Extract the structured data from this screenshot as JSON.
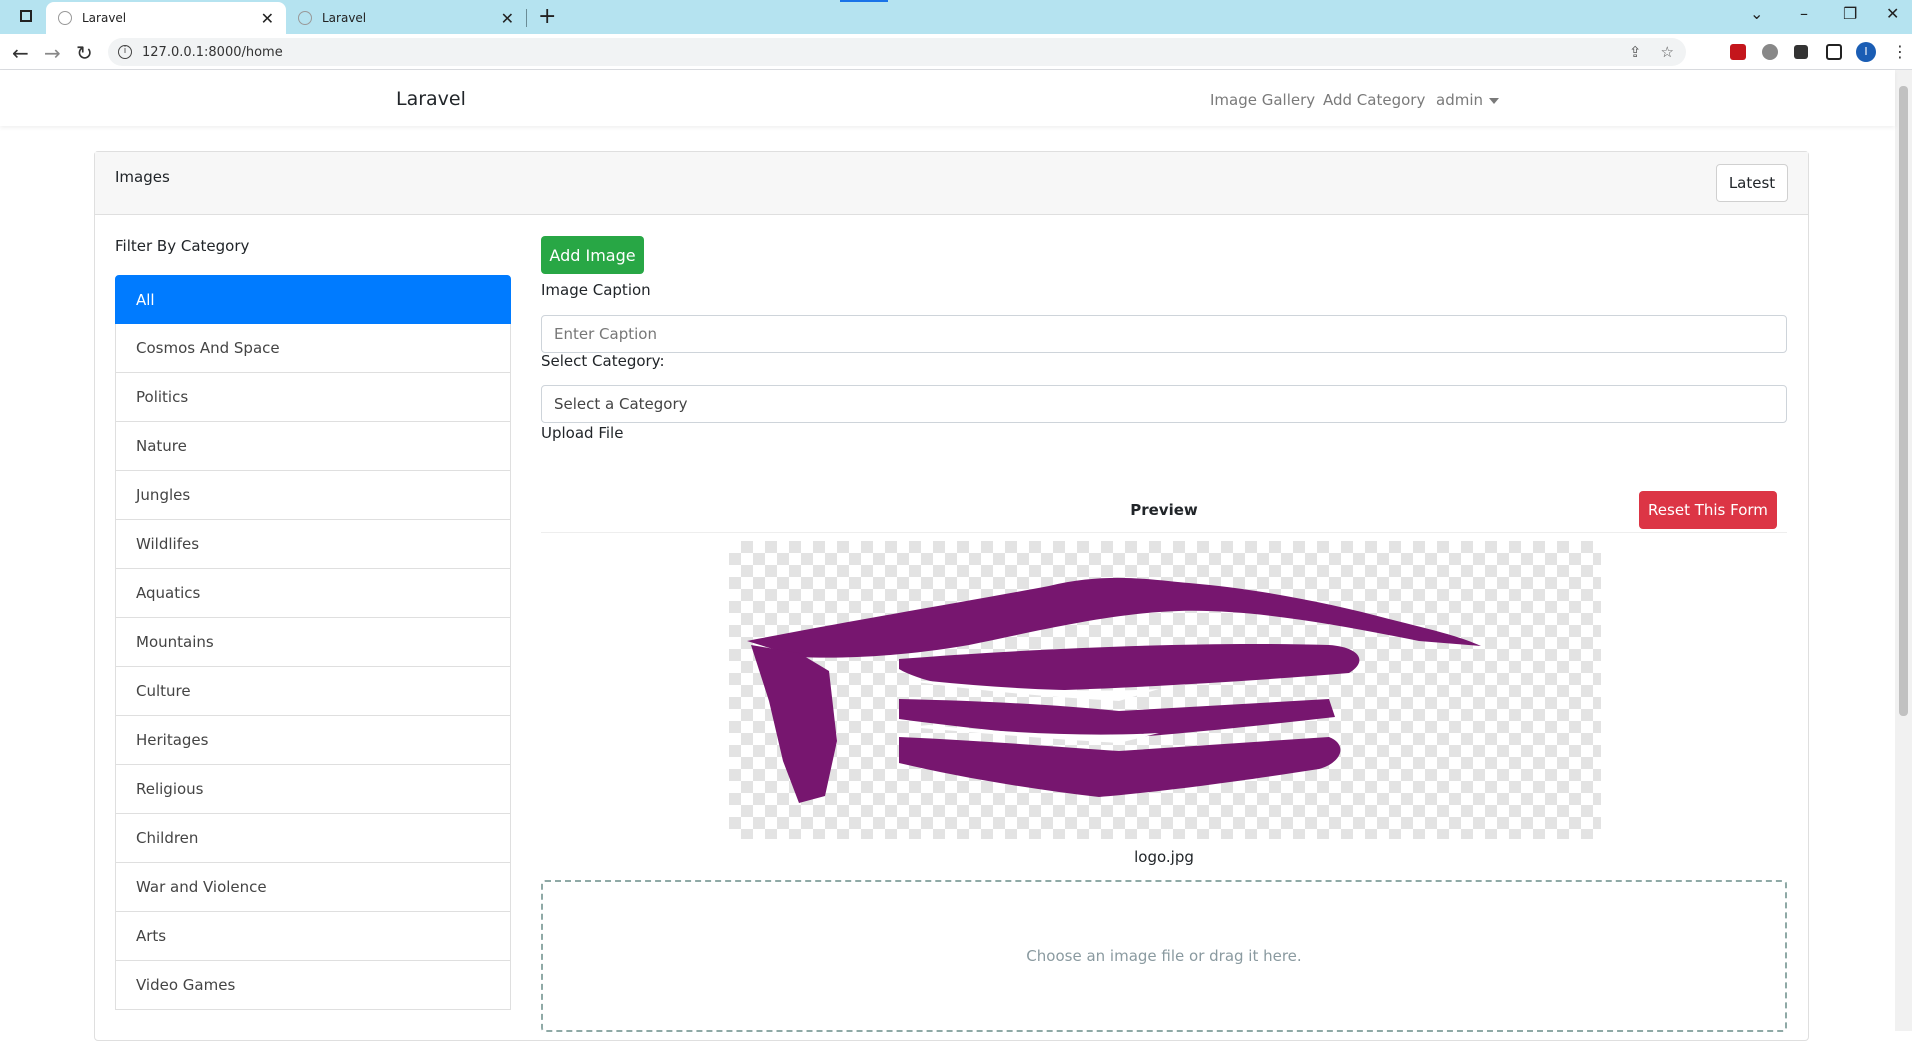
{
  "browser": {
    "tabs": [
      {
        "title": "Laravel",
        "active": true
      },
      {
        "title": "Laravel",
        "active": false
      }
    ],
    "url": "127.0.0.1:8000/home",
    "profile_initial": "I"
  },
  "navbar": {
    "brand": "Laravel",
    "links": [
      "Image Gallery",
      "Add Category"
    ],
    "user": "admin"
  },
  "card": {
    "title": "Images",
    "latest_label": "Latest"
  },
  "filter": {
    "title": "Filter By Category",
    "categories": [
      "All",
      "Cosmos And Space",
      "Politics",
      "Nature",
      "Jungles",
      "Wildlifes",
      "Aquatics",
      "Mountains",
      "Culture",
      "Heritages",
      "Religious",
      "Children",
      "War and Violence",
      "Arts",
      "Video Games"
    ],
    "active_index": 0
  },
  "form": {
    "add_label": "Add Image",
    "caption_label": "Image Caption",
    "caption_placeholder": "Enter Caption",
    "category_label": "Select Category:",
    "category_value": "Select a Category",
    "upload_label": "Upload File",
    "preview_label": "Preview",
    "reset_label": "Reset This Form",
    "filename": "logo.jpg",
    "dropzone_text": "Choose an image file or drag it here."
  },
  "colors": {
    "primary": "#007bff",
    "success": "#28a745",
    "danger": "#dc3545",
    "logo": "#77166f"
  }
}
